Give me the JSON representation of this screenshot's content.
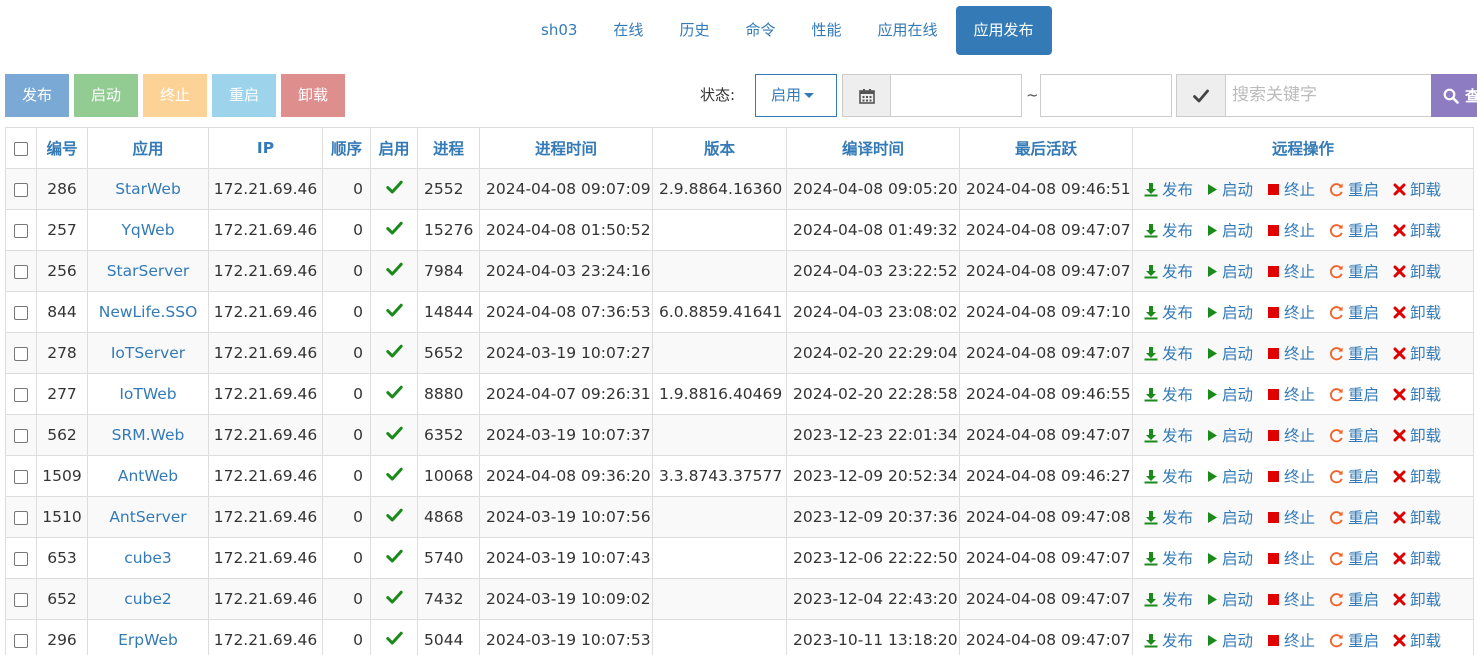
{
  "tabs": [
    {
      "label": "sh03",
      "active": false
    },
    {
      "label": "在线",
      "active": false
    },
    {
      "label": "历史",
      "active": false
    },
    {
      "label": "命令",
      "active": false
    },
    {
      "label": "性能",
      "active": false
    },
    {
      "label": "应用在线",
      "active": false
    },
    {
      "label": "应用发布",
      "active": true
    }
  ],
  "toolbar": {
    "publish": "发布",
    "start": "启动",
    "stop": "终止",
    "restart": "重启",
    "uninstall": "卸载"
  },
  "filters": {
    "status_label": "状态:",
    "status_value": "启用",
    "date_separator": "~",
    "search_placeholder": "搜索关键字",
    "search_button": "查"
  },
  "colors": {
    "accent": "#337ab7",
    "check": "#1a8a1a",
    "publish": "#1a8a1a",
    "start": "#1a8a1a",
    "stop": "#e00000",
    "restart": "#f0642b",
    "uninstall": "#e00000"
  },
  "table": {
    "headers": [
      "编号",
      "应用",
      "IP",
      "顺序",
      "启用",
      "进程",
      "进程时间",
      "版本",
      "编译时间",
      "最后活跃",
      "远程操作"
    ],
    "ops": [
      "发布",
      "启动",
      "终止",
      "重启",
      "卸载"
    ],
    "rows": [
      {
        "id": "286",
        "app": "StarWeb",
        "ip": "172.21.69.46",
        "order": "0",
        "enabled": true,
        "pid": "2552",
        "ptime": "2024-04-08 09:07:09",
        "version": "2.9.8864.16360",
        "ctime": "2024-04-08 09:05:20",
        "last": "2024-04-08 09:46:51"
      },
      {
        "id": "257",
        "app": "YqWeb",
        "ip": "172.21.69.46",
        "order": "0",
        "enabled": true,
        "pid": "15276",
        "ptime": "2024-04-08 01:50:52",
        "version": "",
        "ctime": "2024-04-08 01:49:32",
        "last": "2024-04-08 09:47:07"
      },
      {
        "id": "256",
        "app": "StarServer",
        "ip": "172.21.69.46",
        "order": "0",
        "enabled": true,
        "pid": "7984",
        "ptime": "2024-04-03 23:24:16",
        "version": "",
        "ctime": "2024-04-03 23:22:52",
        "last": "2024-04-08 09:47:07"
      },
      {
        "id": "844",
        "app": "NewLife.SSO",
        "ip": "172.21.69.46",
        "order": "0",
        "enabled": true,
        "pid": "14844",
        "ptime": "2024-04-08 07:36:53",
        "version": "6.0.8859.41641",
        "ctime": "2024-04-03 23:08:02",
        "last": "2024-04-08 09:47:10"
      },
      {
        "id": "278",
        "app": "IoTServer",
        "ip": "172.21.69.46",
        "order": "0",
        "enabled": true,
        "pid": "5652",
        "ptime": "2024-03-19 10:07:27",
        "version": "",
        "ctime": "2024-02-20 22:29:04",
        "last": "2024-04-08 09:47:07"
      },
      {
        "id": "277",
        "app": "IoTWeb",
        "ip": "172.21.69.46",
        "order": "0",
        "enabled": true,
        "pid": "8880",
        "ptime": "2024-04-07 09:26:31",
        "version": "1.9.8816.40469",
        "ctime": "2024-02-20 22:28:58",
        "last": "2024-04-08 09:46:55"
      },
      {
        "id": "562",
        "app": "SRM.Web",
        "ip": "172.21.69.46",
        "order": "0",
        "enabled": true,
        "pid": "6352",
        "ptime": "2024-03-19 10:07:37",
        "version": "",
        "ctime": "2023-12-23 22:01:34",
        "last": "2024-04-08 09:47:07"
      },
      {
        "id": "1509",
        "app": "AntWeb",
        "ip": "172.21.69.46",
        "order": "0",
        "enabled": true,
        "pid": "10068",
        "ptime": "2024-04-08 09:36:20",
        "version": "3.3.8743.37577",
        "ctime": "2023-12-09 20:52:34",
        "last": "2024-04-08 09:46:27"
      },
      {
        "id": "1510",
        "app": "AntServer",
        "ip": "172.21.69.46",
        "order": "0",
        "enabled": true,
        "pid": "4868",
        "ptime": "2024-03-19 10:07:56",
        "version": "",
        "ctime": "2023-12-09 20:37:36",
        "last": "2024-04-08 09:47:08"
      },
      {
        "id": "653",
        "app": "cube3",
        "ip": "172.21.69.46",
        "order": "0",
        "enabled": true,
        "pid": "5740",
        "ptime": "2024-03-19 10:07:43",
        "version": "",
        "ctime": "2023-12-06 22:22:50",
        "last": "2024-04-08 09:47:07"
      },
      {
        "id": "652",
        "app": "cube2",
        "ip": "172.21.69.46",
        "order": "0",
        "enabled": true,
        "pid": "7432",
        "ptime": "2024-03-19 10:09:02",
        "version": "",
        "ctime": "2023-12-04 22:43:20",
        "last": "2024-04-08 09:47:07"
      },
      {
        "id": "296",
        "app": "ErpWeb",
        "ip": "172.21.69.46",
        "order": "0",
        "enabled": true,
        "pid": "5044",
        "ptime": "2024-03-19 10:07:53",
        "version": "",
        "ctime": "2023-10-11 13:18:20",
        "last": "2024-04-08 09:47:07"
      }
    ]
  }
}
